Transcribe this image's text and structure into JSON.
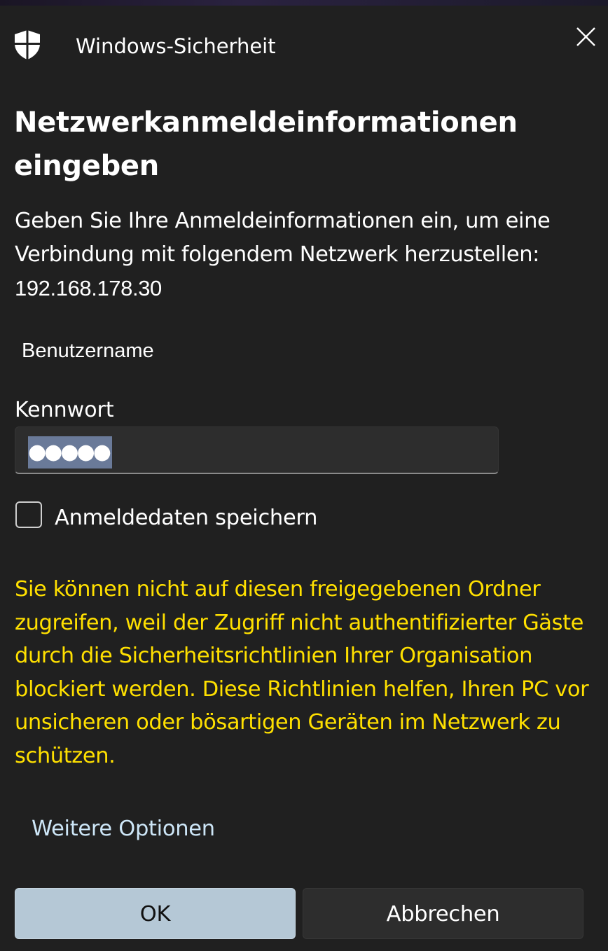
{
  "window": {
    "app_title": "Windows-Sicherheit",
    "close_icon": "close-icon",
    "app_icon": "shield-icon"
  },
  "dialog": {
    "heading": "Netzwerkanmeldeinformationen eingeben",
    "description": "Geben Sie Ihre Anmeldeinformationen ein, um eine Verbindung mit folgendem Netzwerk herzustellen:",
    "network_address": "192.168.178.30"
  },
  "form": {
    "username_label": "Benutzername",
    "password_label": "Kennwort",
    "password_value": "●●●●●",
    "remember_label": "Anmeldedaten speichern",
    "remember_checked": false
  },
  "warning": {
    "text": "Sie können nicht auf diesen freigegebenen Ordner zugreifen, weil der Zugriff nicht authentifizierter Gäste durch die Sicherheitsrichtlinien Ihrer Organisation blockiert werden. Diese Richtlinien helfen, Ihren PC vor unsicheren oder bösartigen Geräten im Netzwerk zu schützen.",
    "color": "#ffe000"
  },
  "actions": {
    "more_options": "Weitere Optionen",
    "ok_label": "OK",
    "cancel_label": "Abbrechen"
  },
  "colors": {
    "background": "#202020",
    "accent_button": "#b5c8d6",
    "link": "#cde6f7"
  }
}
